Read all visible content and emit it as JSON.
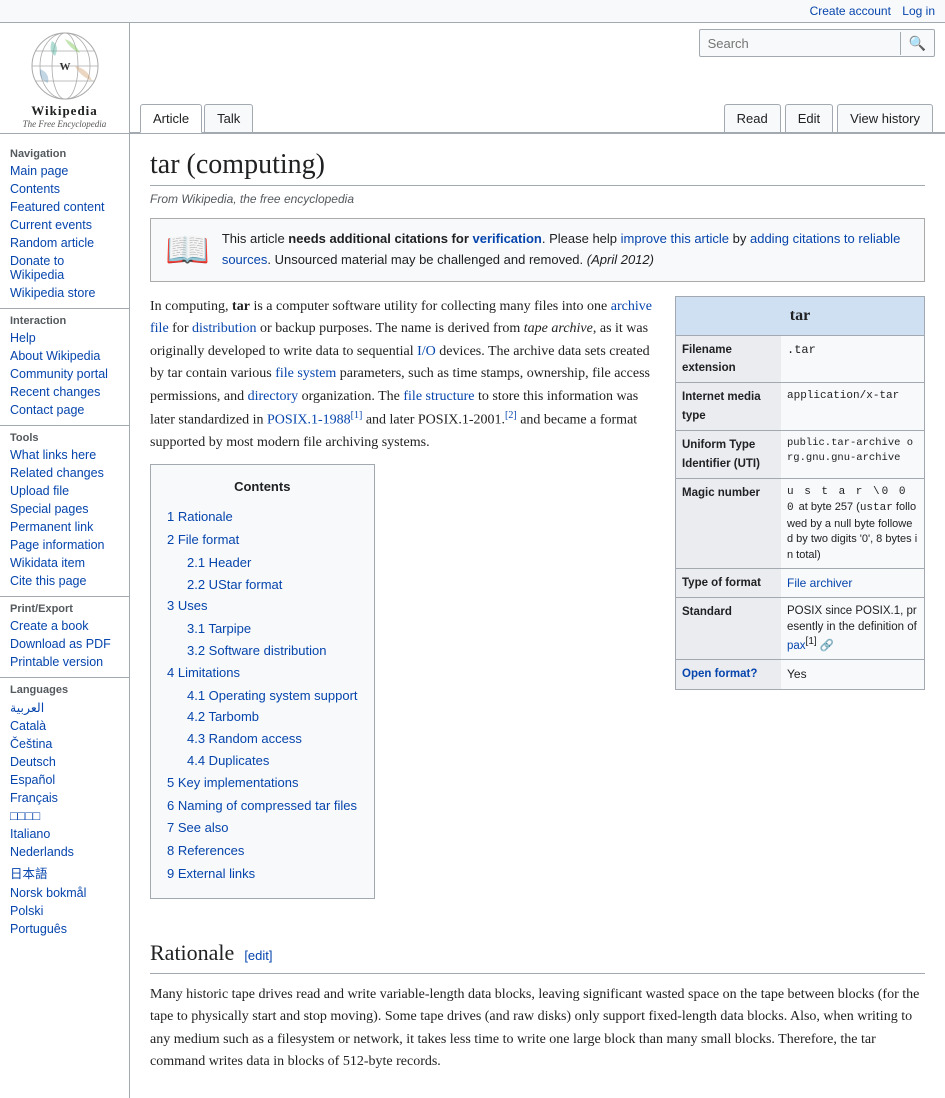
{
  "topbar": {
    "create_account": "Create account",
    "log_in": "Log in"
  },
  "logo": {
    "title": "Wikipedia",
    "subtitle": "The Free Encyclopedia"
  },
  "tabs": {
    "article": "Article",
    "talk": "Talk",
    "read": "Read",
    "edit": "Edit",
    "view_history": "View history"
  },
  "search": {
    "placeholder": "Search",
    "button": "🔍"
  },
  "sidebar": {
    "navigation_title": "Navigation",
    "nav_items": [
      {
        "label": "Main page",
        "href": "#"
      },
      {
        "label": "Contents",
        "href": "#"
      },
      {
        "label": "Featured content",
        "href": "#"
      },
      {
        "label": "Current events",
        "href": "#"
      },
      {
        "label": "Random article",
        "href": "#"
      },
      {
        "label": "Donate to Wikipedia",
        "href": "#"
      },
      {
        "label": "Wikipedia store",
        "href": "#"
      }
    ],
    "interaction_title": "Interaction",
    "interaction_items": [
      {
        "label": "Help",
        "href": "#"
      },
      {
        "label": "About Wikipedia",
        "href": "#"
      },
      {
        "label": "Community portal",
        "href": "#"
      },
      {
        "label": "Recent changes",
        "href": "#"
      },
      {
        "label": "Contact page",
        "href": "#"
      }
    ],
    "tools_title": "Tools",
    "tools_items": [
      {
        "label": "What links here",
        "href": "#"
      },
      {
        "label": "Related changes",
        "href": "#"
      },
      {
        "label": "Upload file",
        "href": "#"
      },
      {
        "label": "Special pages",
        "href": "#"
      },
      {
        "label": "Permanent link",
        "href": "#"
      },
      {
        "label": "Page information",
        "href": "#"
      },
      {
        "label": "Wikidata item",
        "href": "#"
      },
      {
        "label": "Cite this page",
        "href": "#"
      }
    ],
    "print_title": "Print/export",
    "print_items": [
      {
        "label": "Create a book",
        "href": "#"
      },
      {
        "label": "Download as PDF",
        "href": "#"
      },
      {
        "label": "Printable version",
        "href": "#"
      }
    ],
    "languages_title": "Languages",
    "language_items": [
      {
        "label": "العربية",
        "href": "#"
      },
      {
        "label": "Català",
        "href": "#"
      },
      {
        "label": "Čeština",
        "href": "#"
      },
      {
        "label": "Deutsch",
        "href": "#"
      },
      {
        "label": "Español",
        "href": "#"
      },
      {
        "label": "Français",
        "href": "#"
      },
      {
        "label": "□□□□",
        "href": "#"
      },
      {
        "label": "Italiano",
        "href": "#"
      },
      {
        "label": "Nederlands",
        "href": "#"
      },
      {
        "label": "日本語",
        "href": "#"
      },
      {
        "label": "Norsk bokmål",
        "href": "#"
      },
      {
        "label": "Polski",
        "href": "#"
      },
      {
        "label": "Português",
        "href": "#"
      }
    ]
  },
  "page": {
    "title": "tar (computing)",
    "subtitle": "From Wikipedia, the free encyclopedia"
  },
  "notice": {
    "text_before": "This article",
    "bold_text": "needs additional citations for",
    "link_text": "verification",
    "text_after": ". Please help",
    "link2_text": "improve this article",
    "text2": "by",
    "link3_text": "adding citations to reliable sources",
    "text3": ". Unsourced material may be challenged and removed.",
    "date": "(April 2012)"
  },
  "infobox": {
    "title": "tar",
    "rows": [
      {
        "label": "Filename extension",
        "value": ".tar"
      },
      {
        "label": "Internet media type",
        "value": "application/x-tar"
      },
      {
        "label": "Uniform Type Identifier (UTI)",
        "value": "public.tar-archive org.gnu.gnu-archive"
      },
      {
        "label": "Magic number",
        "value": "u s t a r \\0 0 0 at byte 257 (ustar followed by a null byte followed by two digits '0', 8 bytes in total)"
      },
      {
        "label": "Type of format",
        "value": "File archiver"
      },
      {
        "label": "Standard",
        "value": "POSIX since POSIX.1, presently in the definition of pax[1]"
      },
      {
        "label": "Open format?",
        "value": "Yes"
      }
    ]
  },
  "article_intro": "In computing, tar is a computer software utility for collecting many files into one archive file for distribution or backup purposes. The name is derived from tape archive, as it was originally developed to write data to sequential I/O devices. The archive data sets created by tar contain various file system parameters, such as time stamps, ownership, file access permissions, and directory organization. The file structure to store this information was later standardized in POSIX.1-1988[1] and later POSIX.1-2001.[2] and became a format supported by most modern file archiving systems.",
  "toc": {
    "title": "Contents",
    "items": [
      {
        "num": "1",
        "label": "Rationale",
        "href": "#rationale"
      },
      {
        "num": "2",
        "label": "File format",
        "href": "#file-format",
        "subitems": [
          {
            "num": "2.1",
            "label": "Header",
            "href": "#header"
          },
          {
            "num": "2.2",
            "label": "UStar format",
            "href": "#ustar-format"
          }
        ]
      },
      {
        "num": "3",
        "label": "Uses",
        "href": "#uses",
        "subitems": [
          {
            "num": "3.1",
            "label": "Tarpipe",
            "href": "#tarpipe"
          },
          {
            "num": "3.2",
            "label": "Software distribution",
            "href": "#software-distribution"
          }
        ]
      },
      {
        "num": "4",
        "label": "Limitations",
        "href": "#limitations",
        "subitems": [
          {
            "num": "4.1",
            "label": "Operating system support",
            "href": "#os-support"
          },
          {
            "num": "4.2",
            "label": "Tarbomb",
            "href": "#tarbomb"
          },
          {
            "num": "4.3",
            "label": "Random access",
            "href": "#random-access"
          },
          {
            "num": "4.4",
            "label": "Duplicates",
            "href": "#duplicates"
          }
        ]
      },
      {
        "num": "5",
        "label": "Key implementations",
        "href": "#key-implementations"
      },
      {
        "num": "6",
        "label": "Naming of compressed tar files",
        "href": "#naming"
      },
      {
        "num": "7",
        "label": "See also",
        "href": "#see-also"
      },
      {
        "num": "8",
        "label": "References",
        "href": "#references"
      },
      {
        "num": "9",
        "label": "External links",
        "href": "#external-links"
      }
    ]
  },
  "rationale": {
    "heading": "Rationale",
    "edit_label": "[edit]",
    "text": "Many historic tape drives read and write variable-length data blocks, leaving significant wasted space on the tape between blocks (for the tape to physically start and stop moving). Some tape drives (and raw disks) only support fixed-length data blocks. Also, when writing to any medium such as a filesystem or network, it takes less time to write one large block than many small blocks. Therefore, the tar command writes data in blocks of 512-byte records."
  },
  "colors": {
    "link": "#0645ad",
    "notice_bg": "#f8f9fa",
    "sidebar_bg": "#f8f9fa",
    "infobox_header": "#cee0f2",
    "tab_active_bg": "white",
    "tab_bg": "#f8f9fa"
  }
}
